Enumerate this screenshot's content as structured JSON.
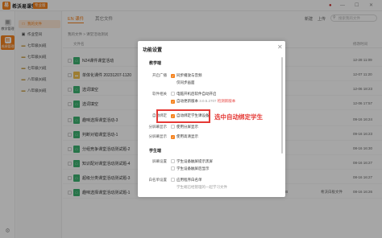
{
  "app": {
    "name": "希沃易课堂",
    "edition": "专业版",
    "logo_text": "易"
  },
  "titlebar": {
    "user_icon": "user-icon",
    "minimize": "—",
    "maximize": "☐",
    "close": "✕"
  },
  "leftbar": {
    "items": [
      {
        "label": "教学管理",
        "icon": "book-icon"
      },
      {
        "label": "成绩管理",
        "icon": "grade-icon"
      }
    ],
    "bottom_icon": "settings-icon"
  },
  "sidebar": {
    "items": [
      {
        "label": "我的文件",
        "icon": "file-icon",
        "active": true
      },
      {
        "label": "作业空间",
        "icon": "homework-icon",
        "active": false
      },
      {
        "label": "七年级(5)班",
        "icon": "folder-icon"
      },
      {
        "label": "七年级(6)班",
        "icon": "folder-icon"
      },
      {
        "label": "七年级(7)班",
        "icon": "folder-icon"
      },
      {
        "label": "八年级(8)班",
        "icon": "folder-icon"
      },
      {
        "label": "八年级(9)班",
        "icon": "folder-icon"
      }
    ]
  },
  "tabs": [
    {
      "label": "EN 课件",
      "active": true
    },
    {
      "label": "其它文件",
      "active": false
    }
  ],
  "toolbar": {
    "new": "新建",
    "upload": "上传",
    "search_placeholder": "搜索我的文件"
  },
  "breadcrumb": "我的文件 > 课堂活动测试",
  "table": {
    "headers": {
      "name": "文件名",
      "size": "",
      "type": "",
      "date": "修改时间"
    },
    "rows": [
      {
        "name": "N24课件课堂活动",
        "size": "",
        "type": "",
        "date": "12-28 11:09"
      },
      {
        "name": "单体化课件 20231207-1120",
        "size": "",
        "type": "",
        "date": "12-07 11:20"
      },
      {
        "name": "选词填空",
        "size": "",
        "type": "",
        "date": "12-06 18:23"
      },
      {
        "name": "选词填空",
        "size": "",
        "type": "",
        "date": "12-06 17:57"
      },
      {
        "name": "趣味选择课堂活动-3",
        "size": "",
        "type": "",
        "date": "09-16 16:24"
      },
      {
        "name": "判断对错课堂活动-1",
        "size": "",
        "type": "",
        "date": "09-16 16:23"
      },
      {
        "name": "分组竞争课堂活动测试题-2",
        "size": "",
        "type": "",
        "date": "08-16 16:30"
      },
      {
        "name": "知识配对课堂活动测试题-4",
        "size": "",
        "type": "",
        "date": "08-16 16:27"
      },
      {
        "name": "超级分类课堂活动测试题-3",
        "size": "",
        "type": "",
        "date": "08-16 16:27"
      },
      {
        "name": "趣味选择课堂活动测试题-1",
        "size": "3.7 MB",
        "type": "希沃白板文件",
        "date": "08-16 16:26"
      }
    ]
  },
  "dialog": {
    "title": "功能设置",
    "close_icon": "✕",
    "section1": "教学端",
    "section2": "学生端",
    "rows": [
      {
        "label": "开启广播",
        "options": [
          {
            "text": "同步播放与音频",
            "checked": true
          },
          {
            "text": "仅同步画面",
            "checked": false
          }
        ]
      },
      {
        "label": "软件相关",
        "options": [
          {
            "text": "电脑开机后软件自动开启",
            "checked": false
          },
          {
            "text": "自动更新版本",
            "checked": true,
            "version": "3.0.5.2707",
            "update": "检测新版本"
          }
        ]
      },
      {
        "label": "自动绑定",
        "options": [
          {
            "text": "自动绑定学生课设备",
            "checked": true
          }
        ]
      },
      {
        "label": "分屏幕显示",
        "options": [
          {
            "text": "使用分屏显示",
            "checked": false
          }
        ]
      },
      {
        "label": "分屏幕显示",
        "options": [
          {
            "text": "使用高清显示",
            "checked": true
          }
        ]
      }
    ],
    "student_rows": [
      {
        "label": "屏幕设置",
        "options": [
          {
            "text": "学生设备触屏提示黑屏",
            "checked": false
          },
          {
            "text": "学生设备触屏后显示",
            "checked": false
          }
        ]
      },
      {
        "label": "白名单设置",
        "options": [
          {
            "text": "应用程序白名单",
            "checked": false
          },
          {
            "text": "学生端已经管理的一起学习文件",
            "checked": false
          }
        ]
      }
    ]
  },
  "annotation": "选中自动绑定学生",
  "colors": {
    "accent": "#f5831f",
    "highlight": "#e53935"
  }
}
